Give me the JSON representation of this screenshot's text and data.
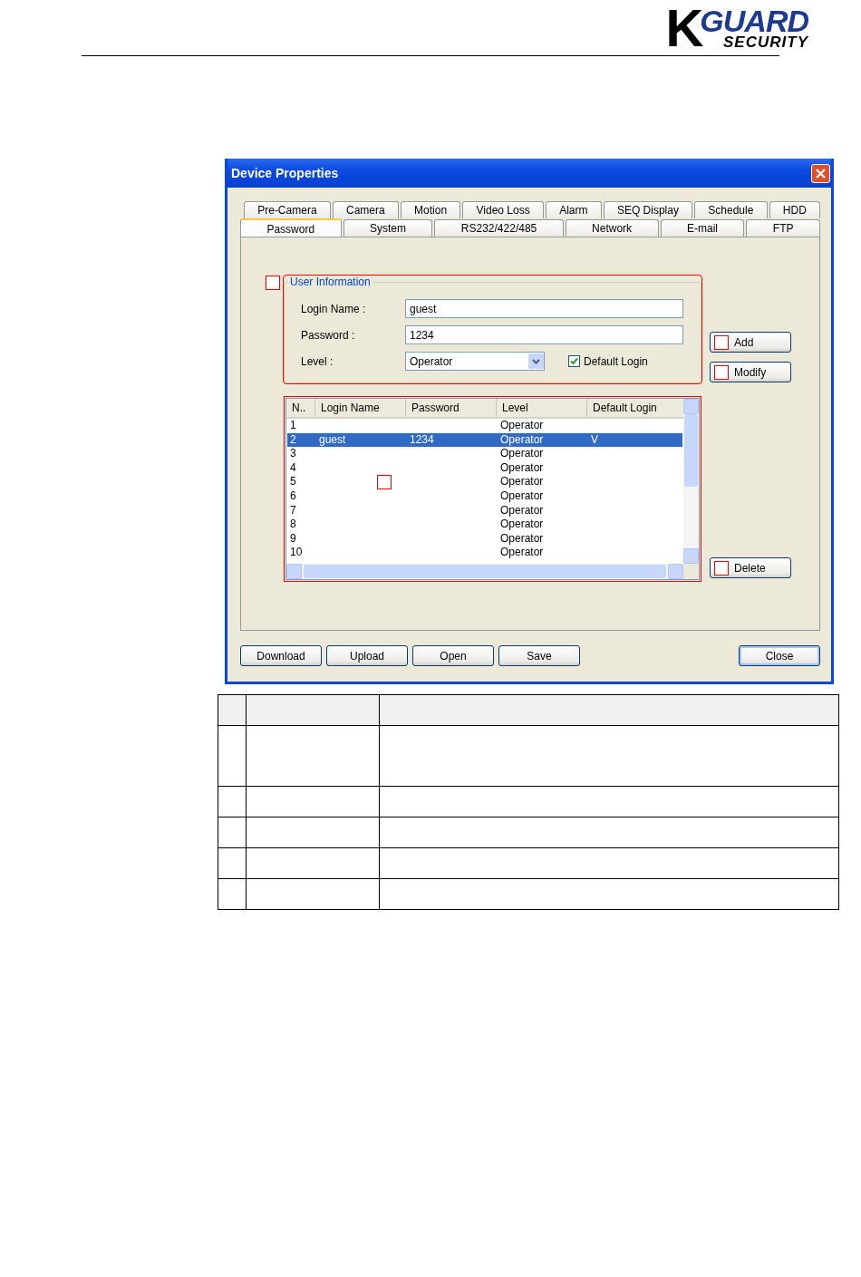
{
  "header": {
    "logo": {
      "brand": "KGUARD",
      "tagline": "SECURITY"
    }
  },
  "dialog": {
    "title": "Device Properties",
    "tab_rows": [
      [
        {
          "label": "Pre-Camera",
          "selected": false
        },
        {
          "label": "Camera",
          "selected": false
        },
        {
          "label": "Motion",
          "selected": false
        },
        {
          "label": "Video Loss",
          "selected": false
        },
        {
          "label": "Alarm",
          "selected": false
        },
        {
          "label": "SEQ Display",
          "selected": false
        },
        {
          "label": "Schedule",
          "selected": false
        },
        {
          "label": "HDD",
          "selected": false
        }
      ],
      [
        {
          "label": "Password",
          "selected": true
        },
        {
          "label": "System",
          "selected": false
        },
        {
          "label": "RS232/422/485",
          "selected": false
        },
        {
          "label": "Network",
          "selected": false
        },
        {
          "label": "E-mail",
          "selected": false
        },
        {
          "label": "FTP",
          "selected": false
        }
      ]
    ],
    "user_information": {
      "legend": "User Information",
      "login_name": {
        "label": "Login Name :",
        "value": "guest"
      },
      "password": {
        "label": "Password :",
        "value": "1234"
      },
      "level": {
        "label": "Level :",
        "value": "Operator"
      },
      "default_login": {
        "label": "Default Login",
        "checked": true
      }
    },
    "side_buttons": [
      "Add",
      "Modify"
    ],
    "user_list": {
      "columns": [
        "N..",
        "Login Name",
        "Password",
        "Level",
        "Default Login"
      ],
      "rows": [
        {
          "cells": [
            "1",
            "",
            "",
            "Operator",
            ""
          ],
          "selected": false
        },
        {
          "cells": [
            "2",
            "guest",
            "1234",
            "Operator",
            "V"
          ],
          "selected": true
        },
        {
          "cells": [
            "3",
            "",
            "",
            "Operator",
            ""
          ],
          "selected": false
        },
        {
          "cells": [
            "4",
            "",
            "",
            "Operator",
            ""
          ],
          "selected": false
        },
        {
          "cells": [
            "5",
            "",
            "",
            "Operator",
            ""
          ],
          "selected": false
        },
        {
          "cells": [
            "6",
            "",
            "",
            "Operator",
            ""
          ],
          "selected": false
        },
        {
          "cells": [
            "7",
            "",
            "",
            "Operator",
            ""
          ],
          "selected": false
        },
        {
          "cells": [
            "8",
            "",
            "",
            "Operator",
            ""
          ],
          "selected": false
        },
        {
          "cells": [
            "9",
            "",
            "",
            "Operator",
            ""
          ],
          "selected": false
        },
        {
          "cells": [
            "10",
            "",
            "",
            "Operator",
            ""
          ],
          "selected": false
        }
      ]
    },
    "delete_button": "Delete",
    "footer_buttons": [
      {
        "label": "Download",
        "default": false
      },
      {
        "label": "Upload",
        "default": false
      },
      {
        "label": "Open",
        "default": false
      },
      {
        "label": "Save",
        "default": false
      },
      {
        "label": "Close",
        "default": true
      }
    ]
  }
}
